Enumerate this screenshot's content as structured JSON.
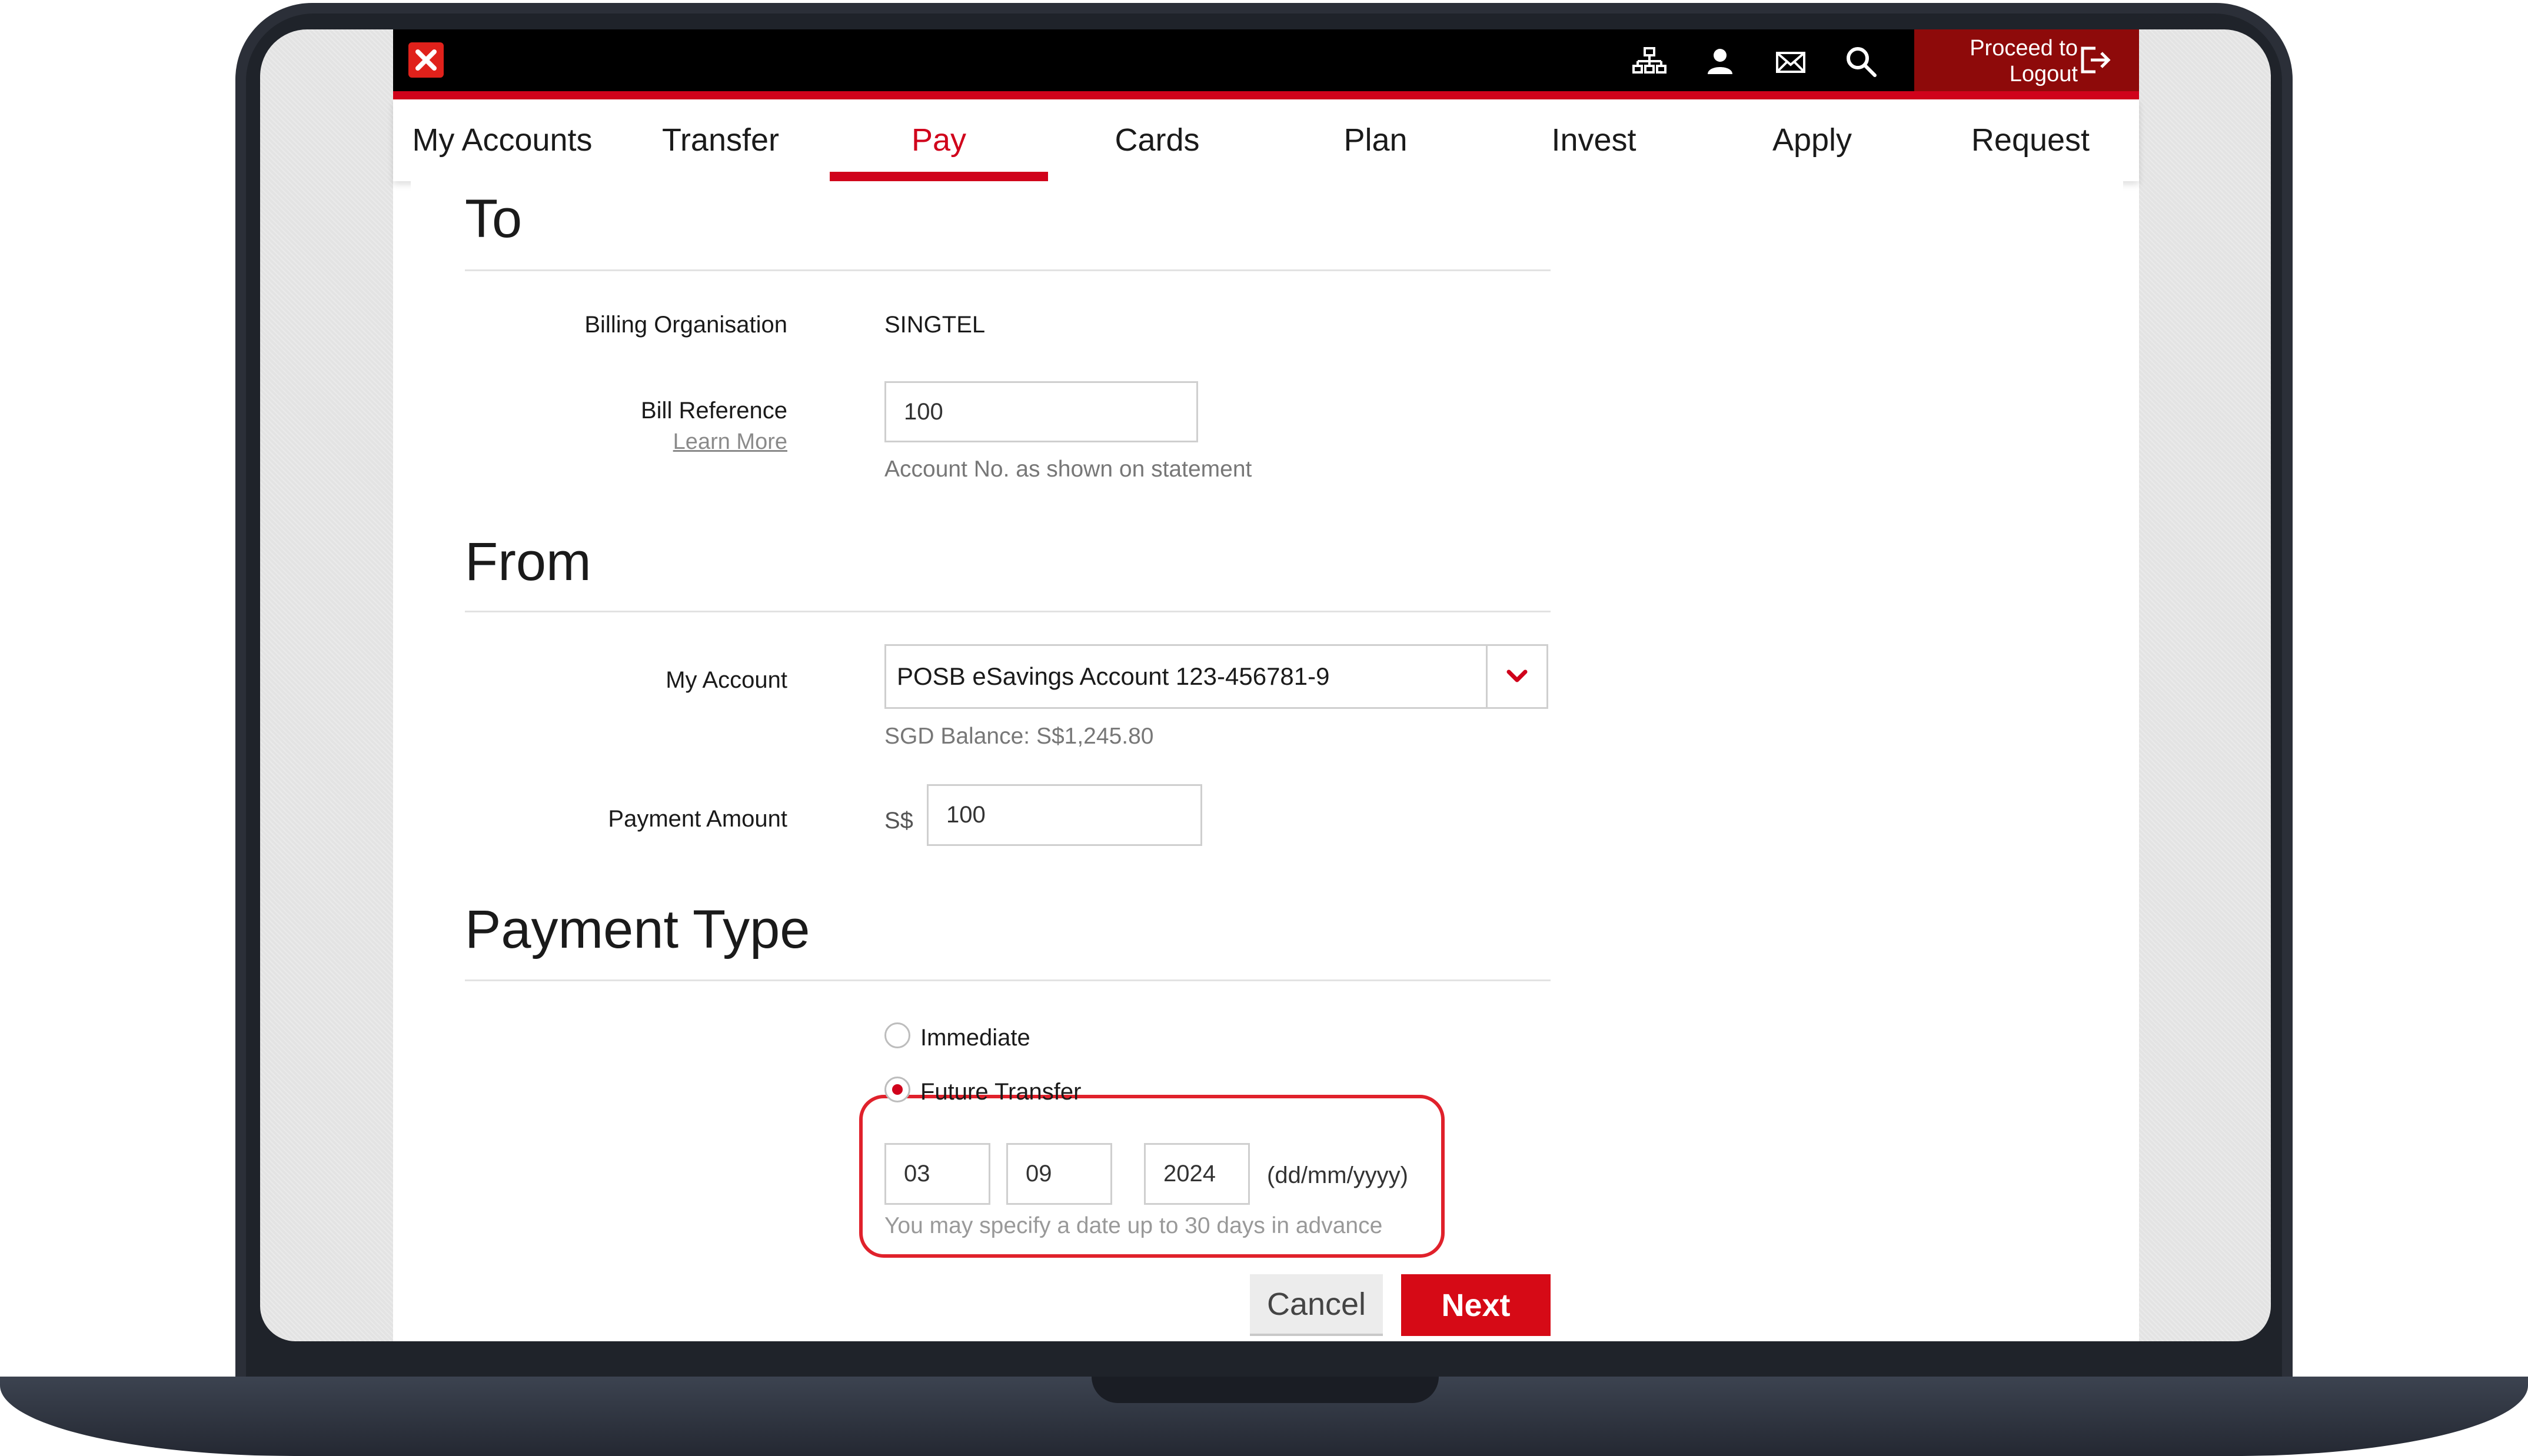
{
  "header": {
    "logout_line1": "Proceed to",
    "logout_line2": "Logout",
    "icons": [
      "sitemap-icon",
      "user-icon",
      "mail-icon",
      "search-icon",
      "logout-icon"
    ]
  },
  "nav": {
    "items": [
      "My Accounts",
      "Transfer",
      "Pay",
      "Cards",
      "Plan",
      "Invest",
      "Apply",
      "Request"
    ],
    "active": "Pay"
  },
  "to": {
    "title": "To",
    "billing_org_label": "Billing Organisation",
    "billing_org_value": "SINGTEL",
    "bill_ref_label": "Bill Reference",
    "learn_more": "Learn More",
    "bill_ref_value": "100",
    "bill_ref_hint": "Account No. as shown on statement"
  },
  "from": {
    "title": "From",
    "account_label": "My Account",
    "account_value": "POSB eSavings Account 123-456781-9",
    "balance": "SGD Balance: S$1,245.80",
    "amount_label": "Payment Amount",
    "currency": "S$",
    "amount_value": "100"
  },
  "payment_type": {
    "title": "Payment Type",
    "immediate_label": "Immediate",
    "future_label": "Future Transfer",
    "selected": "Future Transfer",
    "day": "03",
    "month": "09",
    "year": "2024",
    "date_format": "(dd/mm/yyyy)",
    "date_hint": "You may specify a date up to 30 days in advance"
  },
  "actions": {
    "cancel": "Cancel",
    "next": "Next"
  },
  "colors": {
    "brand_red": "#d0021b",
    "logout_bg": "#8e0a0a",
    "highlight": "#e0212b"
  }
}
